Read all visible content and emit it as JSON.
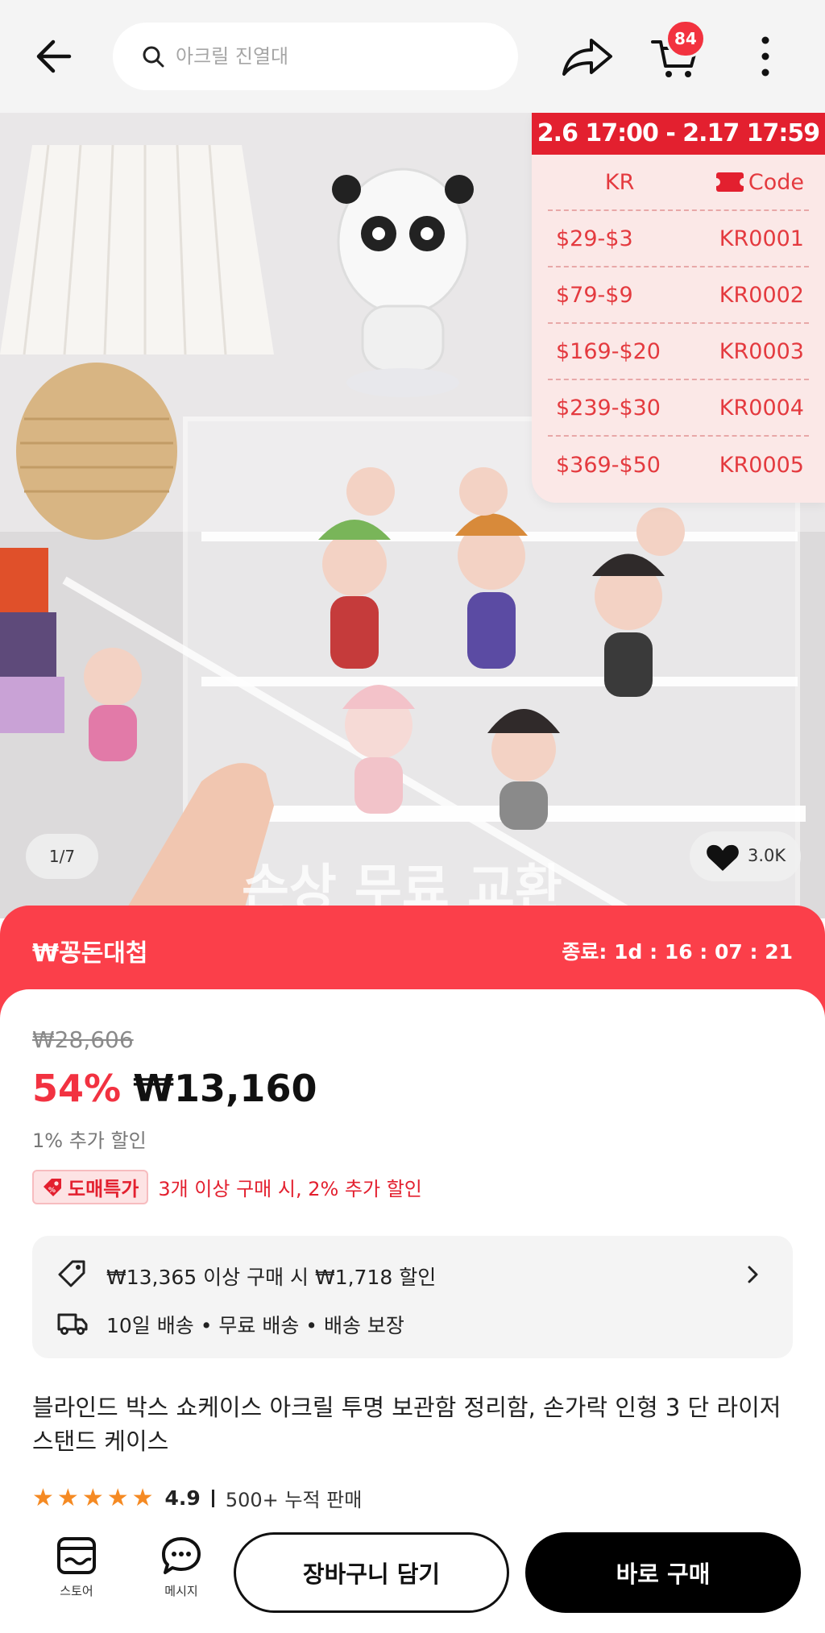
{
  "header": {
    "search_placeholder": "아크릴 진열대",
    "cart_count": "84"
  },
  "gallery": {
    "page_indicator": "1/7",
    "likes": "3.0K",
    "coupon_board": {
      "period": "2.6 17:00 - 2.17 17:59",
      "col_left": "KR",
      "col_right": "Code",
      "rows": [
        {
          "discount": "$29-$3",
          "code": "KR0001"
        },
        {
          "discount": "$79-$9",
          "code": "KR0002"
        },
        {
          "discount": "$169-$20",
          "code": "KR0003"
        },
        {
          "discount": "$239-$30",
          "code": "KR0004"
        },
        {
          "discount": "$369-$50",
          "code": "KR0005"
        }
      ]
    }
  },
  "promo": {
    "title": "₩꽁돈대첩",
    "timer": "종료: 1d : 16 : 07 : 21"
  },
  "price": {
    "original": "₩28,606",
    "discount_pct": "54%",
    "sale": "₩13,160",
    "extra": "1% 추가 할인",
    "wholesale_label": "도매특가",
    "wholesale_text": "3개 이상 구매 시, 2% 추가 할인"
  },
  "info": {
    "coupon_text": "₩13,365 이상 구매 시 ₩1,718 할인",
    "shipping_text": "10일 배송 • 무료 배송 • 배송 보장"
  },
  "product": {
    "title": "블라인드 박스 쇼케이스 아크릴 투명 보관함 정리함, 손가락 인형 3 단 라이저 스탠드 케이스",
    "rating": "4.9",
    "sold": "500+ 누적 판매"
  },
  "bottom": {
    "store_label": "스토어",
    "message_label": "메시지",
    "add_cart_label": "장바구니 담기",
    "buy_now_label": "바로 구매"
  },
  "colors": {
    "accent_red": "#f23241",
    "promo_red": "#fb3f4a",
    "star_orange": "#f58a23"
  }
}
